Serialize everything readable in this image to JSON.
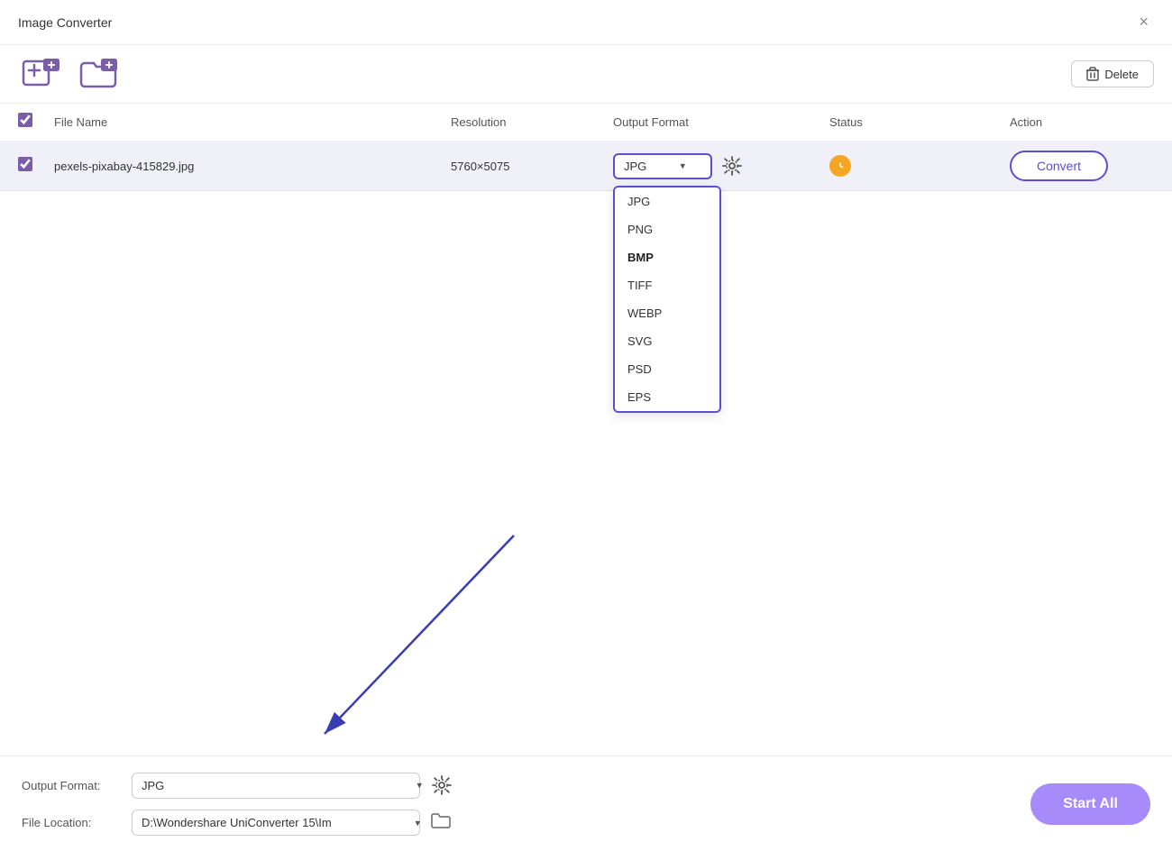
{
  "titleBar": {
    "title": "Image Converter",
    "closeLabel": "×"
  },
  "toolbar": {
    "addFileLabel": "add-file",
    "addFolderLabel": "add-folder",
    "deleteLabel": "Delete"
  },
  "tableHeader": {
    "checkbox": "",
    "fileName": "File Name",
    "resolution": "Resolution",
    "outputFormat": "Output Format",
    "status": "Status",
    "action": "Action"
  },
  "tableRow": {
    "fileName": "pexels-pixabay-415829.jpg",
    "resolution": "5760×5075",
    "selectedFormat": "JPG"
  },
  "formatDropdown": {
    "options": [
      "JPG",
      "PNG",
      "BMP",
      "TIFF",
      "WEBP",
      "SVG",
      "PSD",
      "EPS"
    ],
    "selectedIndex": 2
  },
  "convertButton": {
    "label": "Convert"
  },
  "bottomBar": {
    "outputFormatLabel": "Output Format:",
    "outputFormatValue": "JPG",
    "fileLocationLabel": "File Location:",
    "fileLocationValue": "D:\\Wondershare UniConverter 15\\Im",
    "startAllLabel": "Start All"
  }
}
